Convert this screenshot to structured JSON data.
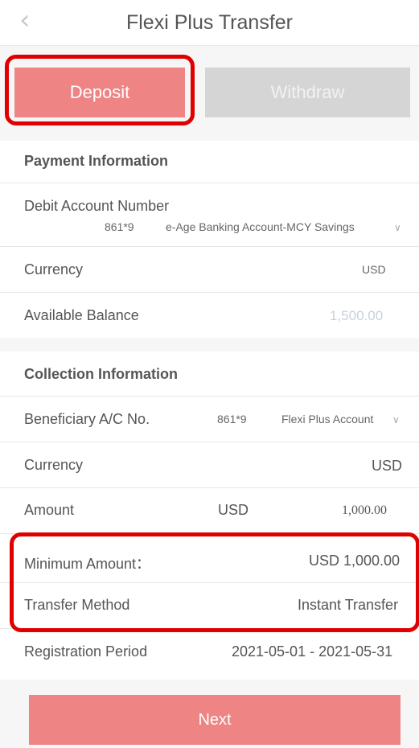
{
  "header": {
    "back_icon": "chevron-left-icon",
    "title": "Flexi Plus Transfer"
  },
  "tabs": {
    "deposit": "Deposit",
    "withdraw": "Withdraw"
  },
  "payment": {
    "title": "Payment Information",
    "debit_label": "Debit Account Number",
    "debit_account": "861*9",
    "debit_account_name": "e-Age Banking Account-MCY Savings",
    "currency_label": "Currency",
    "currency": "USD",
    "balance_label": "Available Balance",
    "balance": "1,500.00"
  },
  "collection": {
    "title": "Collection Information",
    "beneficiary_label": "Beneficiary A/C No.",
    "beneficiary_account": "861*9",
    "beneficiary_name": "Flexi Plus Account",
    "currency_label": "Currency",
    "currency": "USD",
    "amount_label": "Amount",
    "amount_currency": "USD",
    "amount_value": "1,000.00",
    "min_label": "Minimum Amount：",
    "min_value": "USD 1,000.00",
    "method_label": "Transfer Method",
    "method_value": "Instant Transfer",
    "period_label": "Registration Period",
    "period_value": "2021-05-01 - 2021-05-31"
  },
  "next_label": "Next",
  "colors": {
    "accent": "#ee8484",
    "inactive_tab": "#d5d5d5",
    "highlight": "#e00000"
  }
}
